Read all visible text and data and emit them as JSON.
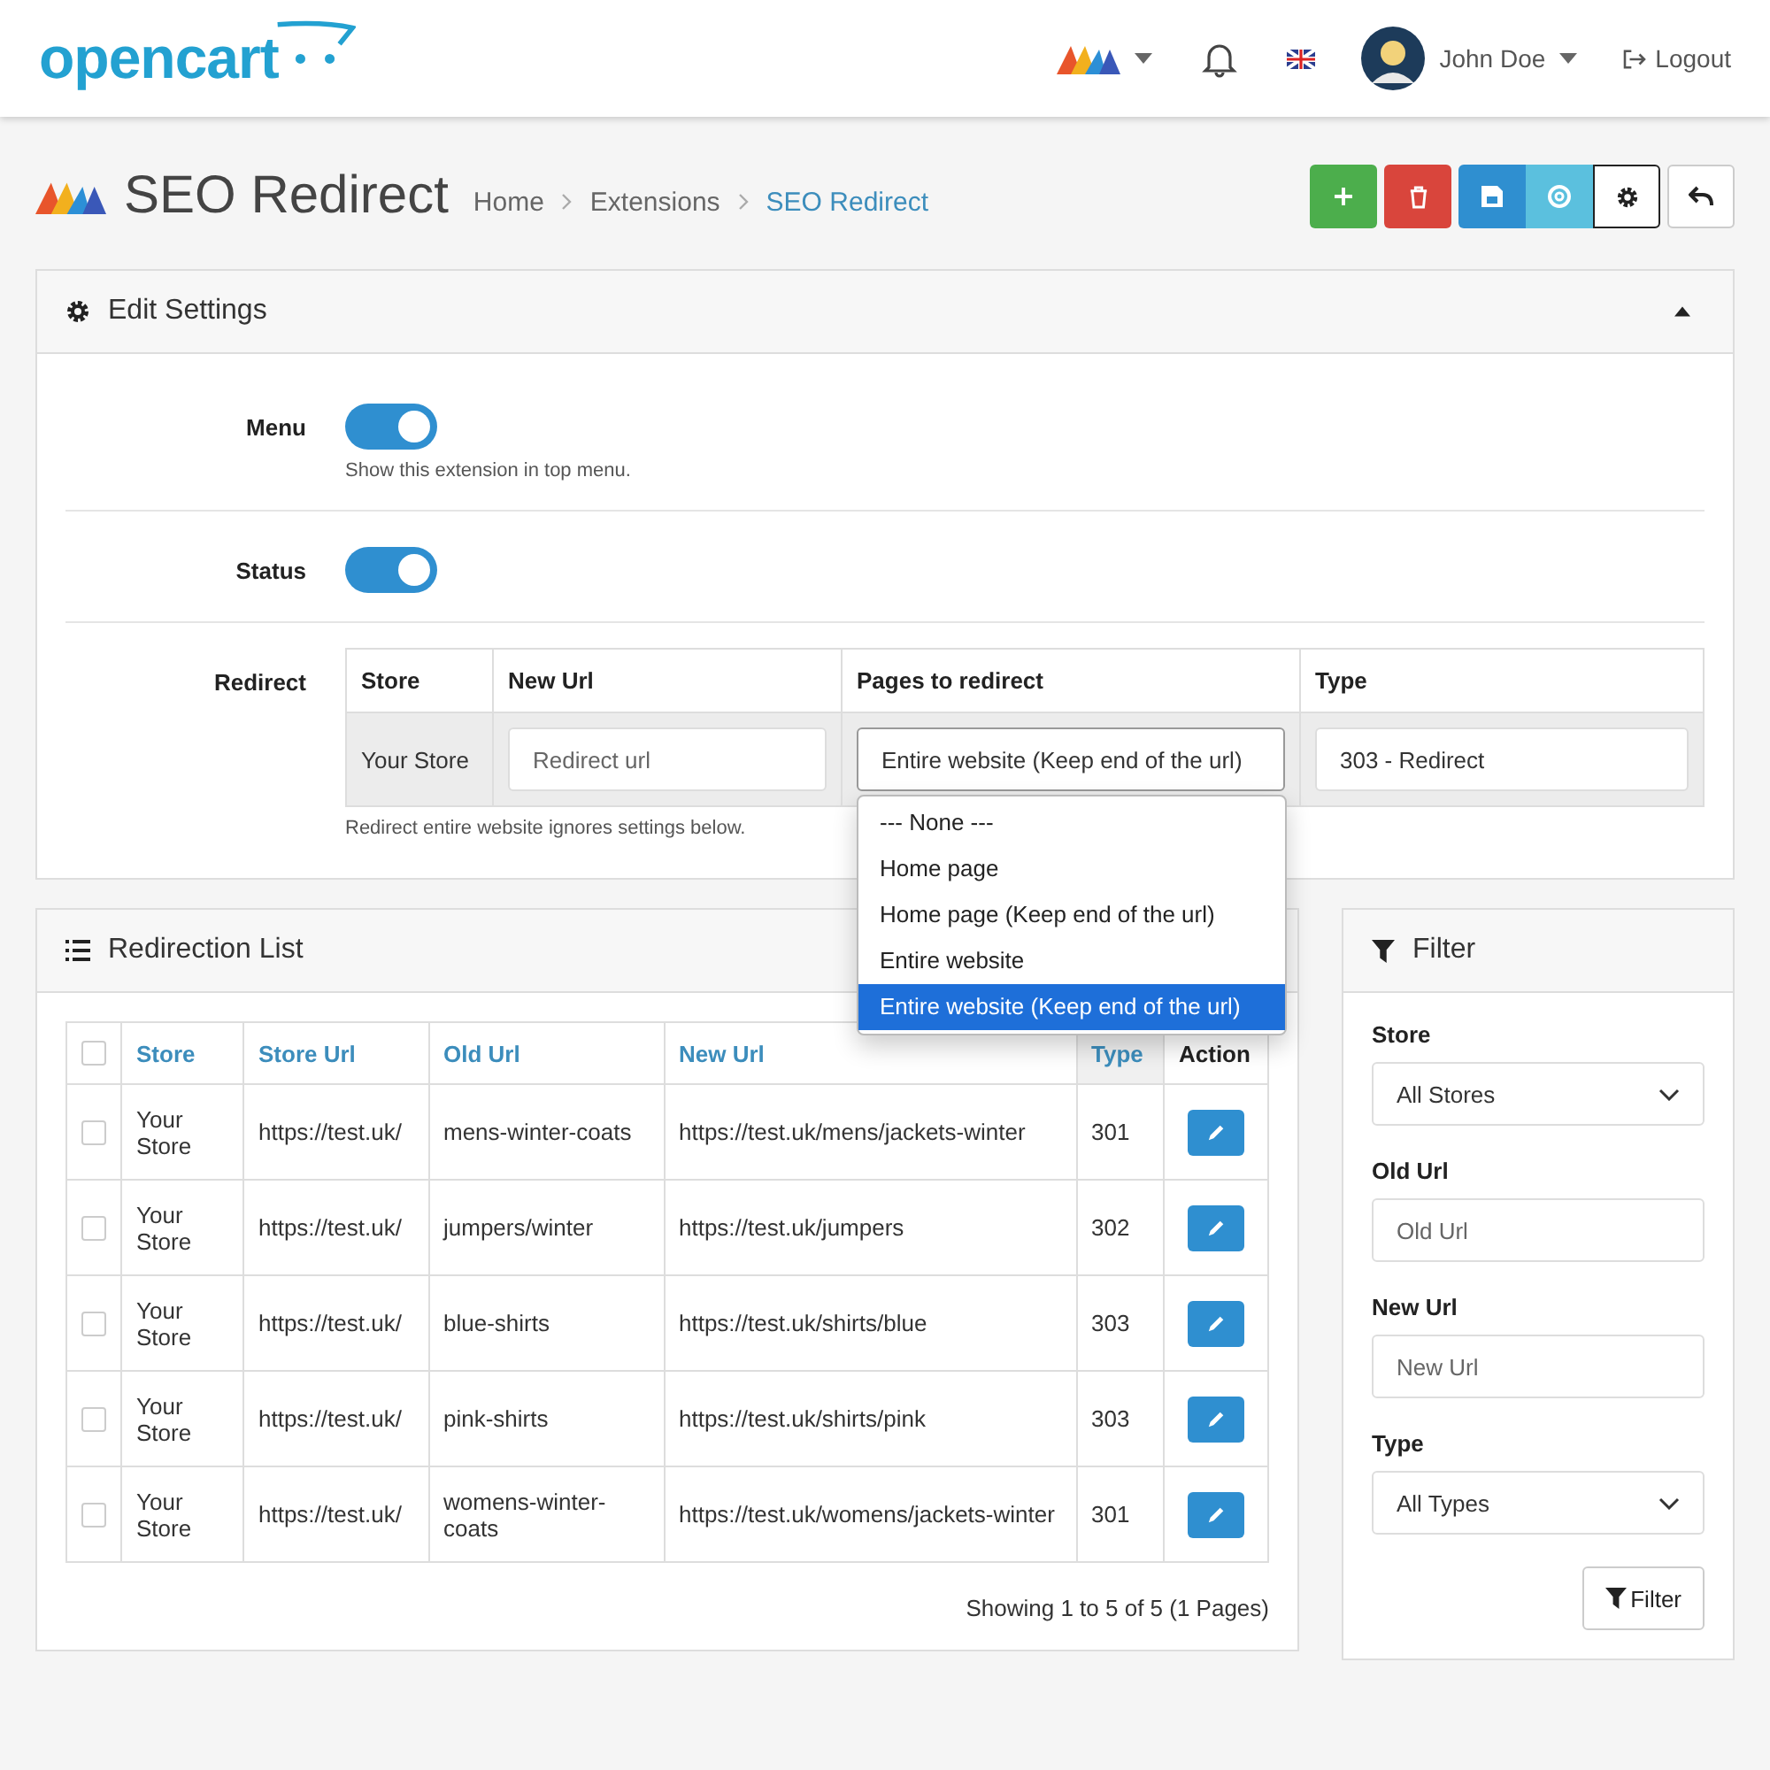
{
  "header": {
    "logo": "opencart",
    "user": "John Doe",
    "logout": "Logout"
  },
  "page": {
    "title": "SEO Redirect",
    "breadcrumbs": [
      {
        "label": "Home",
        "selected": false
      },
      {
        "label": "Extensions",
        "selected": false
      },
      {
        "label": "SEO Redirect",
        "selected": true
      }
    ]
  },
  "toolbar": [
    {
      "kind": "add"
    },
    {
      "kind": "delete"
    },
    {
      "kind": "save"
    },
    {
      "kind": "support"
    },
    {
      "kind": "settings"
    },
    {
      "kind": "back"
    }
  ],
  "settings": {
    "title": "Edit Settings",
    "expanded": true,
    "menu": {
      "label": "Menu",
      "on": true,
      "help": "Show this extension in top menu."
    },
    "status": {
      "label": "Status",
      "on": true
    },
    "redirect": {
      "label": "Redirect",
      "columns": [
        "Store",
        "New Url",
        "Pages to redirect",
        "Type"
      ],
      "store": "Your Store",
      "new_url": {
        "placeholder": "Redirect url"
      },
      "pages": "Entire website (Keep end of the url)",
      "type": "303 - Redirect",
      "help": "Redirect entire website ignores settings below.",
      "dropdown": [
        {
          "label": "--- None ---",
          "selected": false
        },
        {
          "label": "Home page",
          "selected": false
        },
        {
          "label": "Home page (Keep end of the url)",
          "selected": false
        },
        {
          "label": "Entire website",
          "selected": false
        },
        {
          "label": "Entire website (Keep end of the url)",
          "selected": true
        }
      ]
    }
  },
  "list": {
    "title": "Redirection List",
    "all_checked": false,
    "columns": [
      {
        "label": "Store",
        "kind": "link",
        "sorted": false
      },
      {
        "label": "Store Url",
        "kind": "link",
        "sorted": false
      },
      {
        "label": "Old Url",
        "kind": "link",
        "sorted": false
      },
      {
        "label": "New Url",
        "kind": "link",
        "sorted": false
      },
      {
        "label": "Type",
        "kind": "link",
        "sorted": true
      },
      {
        "label": "Action",
        "kind": "plain",
        "sorted": false
      }
    ],
    "rows": [
      {
        "checked": false,
        "store": "Your Store",
        "store_url": "https://test.uk/",
        "old_url": "mens-winter-coats",
        "new_url": "https://test.uk/mens/jackets-winter",
        "type": "301"
      },
      {
        "checked": false,
        "store": "Your Store",
        "store_url": "https://test.uk/",
        "old_url": "jumpers/winter",
        "new_url": "https://test.uk/jumpers",
        "type": "302"
      },
      {
        "checked": false,
        "store": "Your Store",
        "store_url": "https://test.uk/",
        "old_url": "blue-shirts",
        "new_url": "https://test.uk/shirts/blue",
        "type": "303"
      },
      {
        "checked": false,
        "store": "Your Store",
        "store_url": "https://test.uk/",
        "old_url": "pink-shirts",
        "new_url": "https://test.uk/shirts/pink",
        "type": "303"
      },
      {
        "checked": false,
        "store": "Your Store",
        "store_url": "https://test.uk/",
        "old_url": "womens-winter-coats",
        "new_url": "https://test.uk/womens/jackets-winter",
        "type": "301"
      }
    ],
    "pagination": "Showing 1 to 5 of 5 (1 Pages)"
  },
  "filter": {
    "title": "Filter",
    "store": {
      "label": "Store",
      "value": "All Stores"
    },
    "old_url": {
      "label": "Old Url",
      "placeholder": "Old Url"
    },
    "new_url": {
      "label": "New Url",
      "placeholder": "New Url"
    },
    "type": {
      "label": "Type",
      "value": "All Types"
    },
    "button": "Filter"
  }
}
